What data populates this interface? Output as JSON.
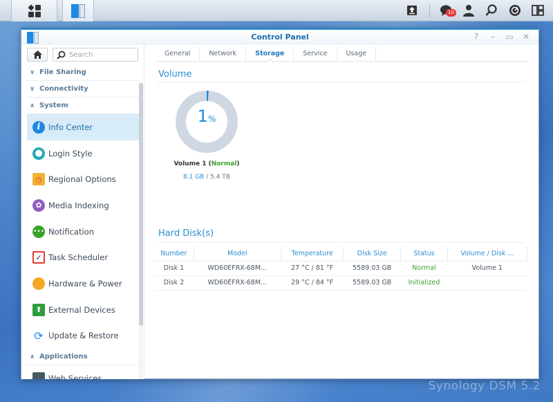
{
  "taskbar": {
    "main_menu_icon": "grid-icon",
    "open_app_icon": "control-panel-icon",
    "tray": [
      {
        "name": "upload-icon",
        "glyph": "⬆"
      },
      {
        "name": "notification-icon",
        "glyph": "💬",
        "badge": "10"
      },
      {
        "name": "user-icon",
        "glyph": "👤"
      },
      {
        "name": "search-icon",
        "glyph": "⚲"
      },
      {
        "name": "resource-monitor-icon",
        "glyph": "◔"
      },
      {
        "name": "widgets-icon",
        "glyph": "▯"
      }
    ],
    "notification_badge": "10"
  },
  "window": {
    "title": "Control Panel",
    "controls": {
      "help": "?",
      "minimize": "–",
      "maximize": "▭",
      "close": "✕"
    }
  },
  "sidebar": {
    "search_placeholder": "Search",
    "categories": [
      {
        "label": "File Sharing",
        "expanded": false
      },
      {
        "label": "Connectivity",
        "expanded": false
      },
      {
        "label": "System",
        "expanded": true
      },
      {
        "label": "Applications",
        "expanded": true
      }
    ],
    "items": [
      {
        "label": "Info Center",
        "icon": "info-icon",
        "active": true
      },
      {
        "label": "Login Style",
        "icon": "palette-icon"
      },
      {
        "label": "Regional Options",
        "icon": "regional-clock-icon"
      },
      {
        "label": "Media Indexing",
        "icon": "film-reel-icon"
      },
      {
        "label": "Notification",
        "icon": "chat-bubble-icon"
      },
      {
        "label": "Task Scheduler",
        "icon": "calendar-check-icon"
      },
      {
        "label": "Hardware & Power",
        "icon": "lightbulb-icon"
      },
      {
        "label": "External Devices",
        "icon": "external-device-icon"
      },
      {
        "label": "Update & Restore",
        "icon": "refresh-icon"
      },
      {
        "label": "Web Services",
        "icon": "web-services-icon"
      }
    ]
  },
  "tabs": [
    {
      "label": "General"
    },
    {
      "label": "Network"
    },
    {
      "label": "Storage",
      "active": true
    },
    {
      "label": "Service"
    },
    {
      "label": "Usage"
    }
  ],
  "volume": {
    "section_title": "Volume",
    "usage_percent": 1,
    "usage_number": "1",
    "usage_unit": "%",
    "name": "Volume 1",
    "status": "Normal",
    "used": "8.1 GB",
    "separator": " / ",
    "total": "5.4 TB",
    "colors": {
      "ring": "#cfd8e2",
      "used": "#1f8ad6",
      "status": "#3aa12c"
    }
  },
  "hard_disks": {
    "section_title": "Hard Disk(s)",
    "columns": [
      "Number",
      "Model",
      "Temperature",
      "Disk Size",
      "Status",
      "Volume / Disk ..."
    ],
    "rows": [
      [
        "Disk 1",
        "WD60EFRX-68M...",
        "27 °C / 81 °F",
        "5589.03 GB",
        "Normal",
        "Volume 1"
      ],
      [
        "Disk 2",
        "WD60EFRX-68M...",
        "29 °C / 84 °F",
        "5589.03 GB",
        "Initialized",
        ""
      ]
    ]
  },
  "watermark": "Synology DSM 5.2"
}
